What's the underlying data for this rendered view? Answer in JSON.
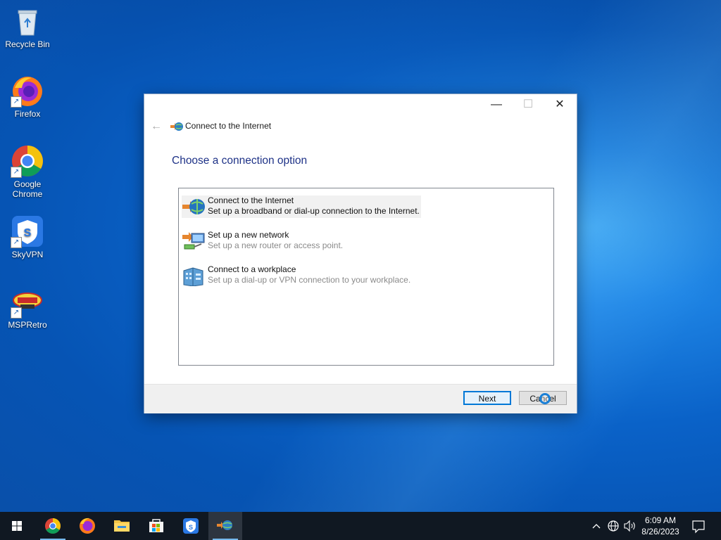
{
  "desktop": {
    "icons": [
      {
        "label": "Recycle Bin",
        "icon": "recycle-bin-icon"
      },
      {
        "label": "Firefox",
        "icon": "firefox-icon"
      },
      {
        "label": "Google Chrome",
        "icon": "chrome-icon"
      },
      {
        "label": "SkyVPN",
        "icon": "skyvpn-icon"
      },
      {
        "label": "MSPRetro",
        "icon": "mspretro-icon"
      }
    ]
  },
  "dialog": {
    "title": "Connect to the Internet",
    "heading": "Choose a connection option",
    "options": [
      {
        "title": "Connect to the Internet",
        "desc": "Set up a broadband or dial-up connection to the Internet.",
        "selected": true,
        "icon": "internet-globe-icon"
      },
      {
        "title": "Set up a new network",
        "desc": "Set up a new router or access point.",
        "selected": false,
        "icon": "new-network-icon"
      },
      {
        "title": "Connect to a workplace",
        "desc": "Set up a dial-up or VPN connection to your workplace.",
        "selected": false,
        "icon": "workplace-icon"
      }
    ],
    "buttons": {
      "next": "Next",
      "cancel": "Cancel"
    }
  },
  "taskbar": {
    "apps": [
      "start-icon",
      "chrome-icon",
      "firefox-icon",
      "file-explorer-icon",
      "microsoft-store-icon",
      "skyvpn-icon",
      "connect-internet-icon"
    ],
    "clock": {
      "time": "6:09 AM",
      "date": "8/26/2023"
    }
  }
}
